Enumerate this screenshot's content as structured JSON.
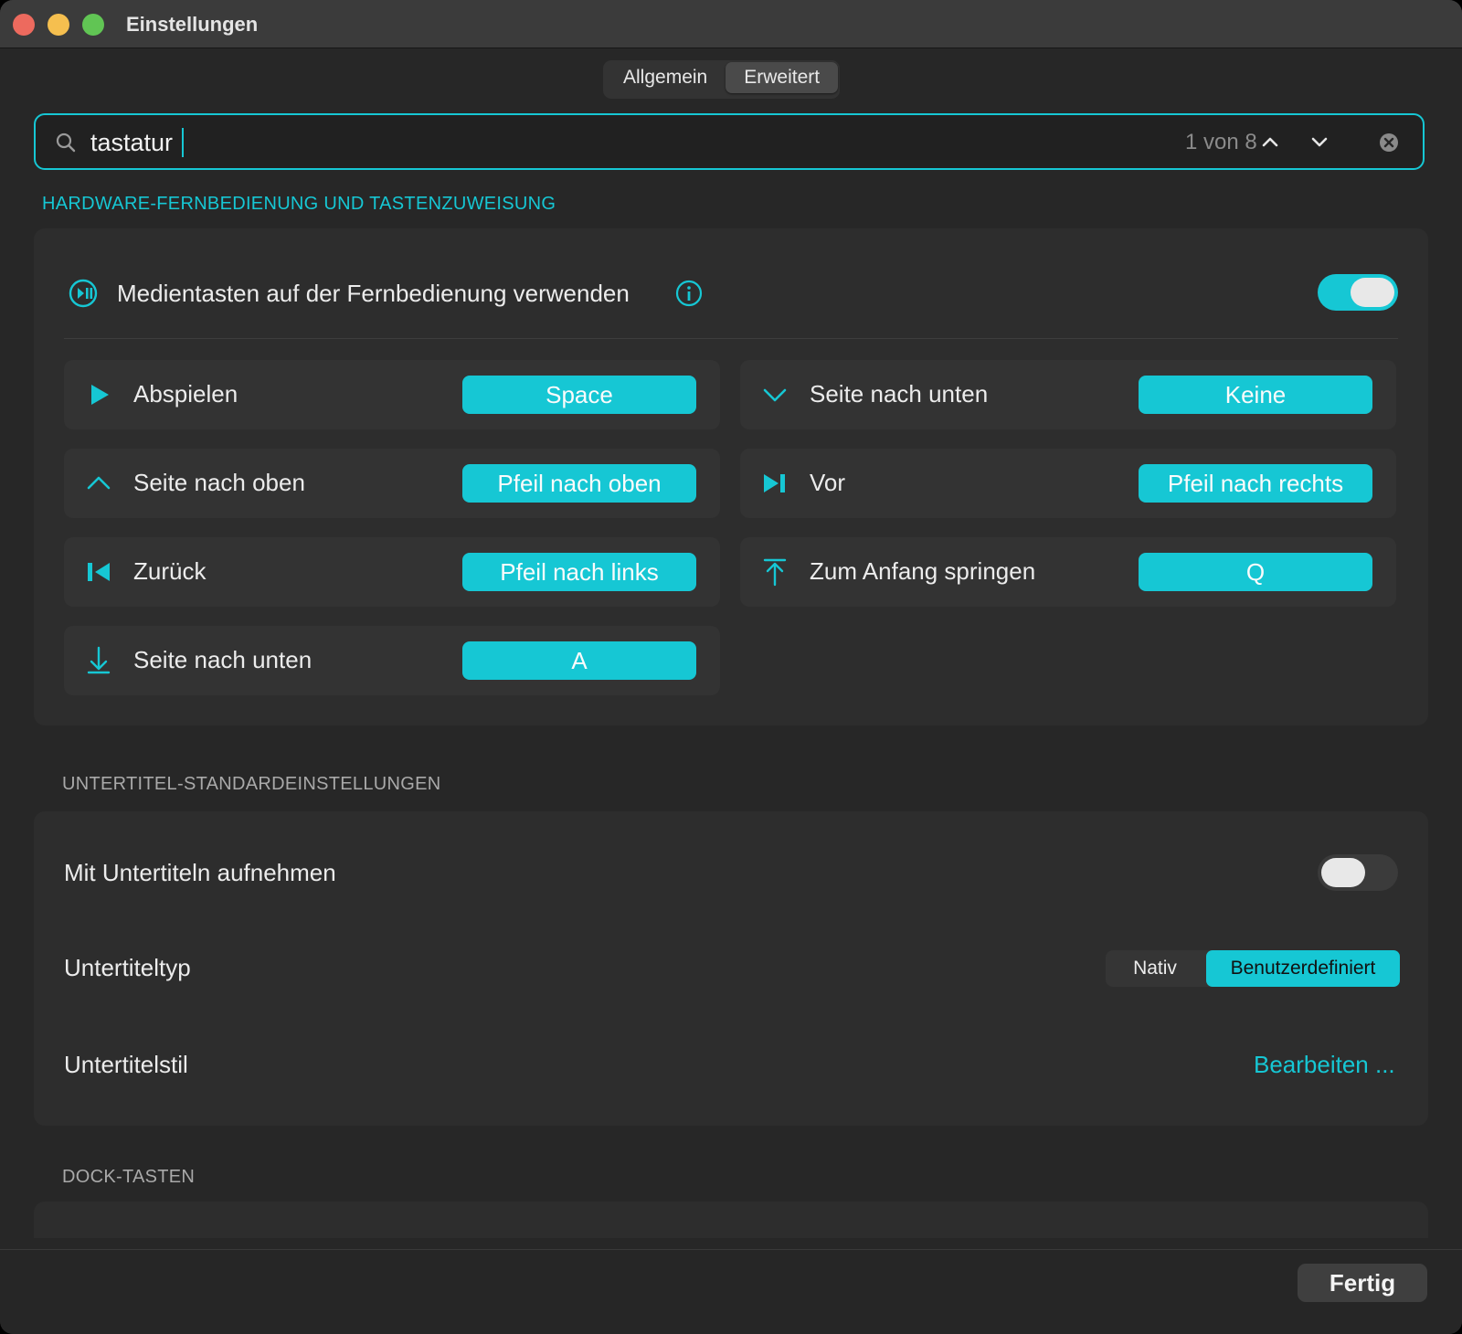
{
  "window": {
    "title": "Einstellungen"
  },
  "tabs": [
    {
      "label": "Allgemein",
      "active": false
    },
    {
      "label": "Erweitert",
      "active": true
    }
  ],
  "search": {
    "value": "tastatur",
    "match_count": "1 von 8"
  },
  "hardware": {
    "title": "HARDWARE-FERNBEDIENUNG UND TASTENZUWEISUNG",
    "media_keys_label": "Medientasten auf der Fernbedienung verwenden",
    "media_keys_enabled": true,
    "mappings": [
      {
        "action": "Abspielen",
        "key": "Space",
        "icon": "play-icon"
      },
      {
        "action": "Seite nach unten",
        "key": "Keine",
        "icon": "chevron-down-icon"
      },
      {
        "action": "Seite nach oben",
        "key": "Pfeil nach oben",
        "icon": "chevron-up-icon"
      },
      {
        "action": "Vor",
        "key": "Pfeil nach rechts",
        "icon": "skip-forward-icon"
      },
      {
        "action": "Zurück",
        "key": "Pfeil nach links",
        "icon": "skip-back-icon"
      },
      {
        "action": "Zum Anfang springen",
        "key": "Q",
        "icon": "jump-to-top-icon"
      },
      {
        "action": "Seite nach unten",
        "key": "A",
        "icon": "arrow-down-icon"
      }
    ]
  },
  "subtitles": {
    "title": "UNTERTITEL-STANDARDEINSTELLUNGEN",
    "record_label": "Mit Untertiteln aufnehmen",
    "record_enabled": false,
    "type_label": "Untertiteltyp",
    "type_options": [
      "Nativ",
      "Benutzerdefiniert"
    ],
    "type_selected": "Benutzerdefiniert",
    "style_label": "Untertitelstil",
    "style_action": "Bearbeiten ..."
  },
  "dock": {
    "title": "DOCK-TASTEN"
  },
  "footer": {
    "done_label": "Fertig"
  },
  "colors": {
    "accent": "#16c7d4",
    "background": "#272727",
    "card": "#2d2d2d"
  }
}
